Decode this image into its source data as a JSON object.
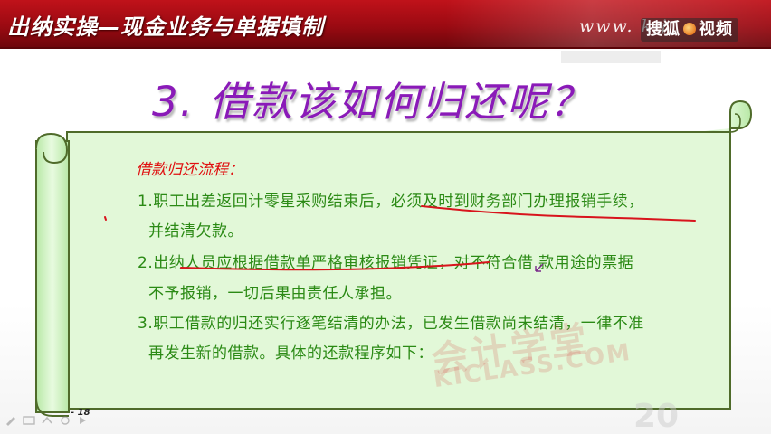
{
  "header": {
    "title": "出纳实操—现金业务与单据填制",
    "url_watermark": "www. k j",
    "logo_text_left": "搜狐",
    "logo_text_right": "视频"
  },
  "slide": {
    "title": "3. 借款该如何归还呢？",
    "flow_heading": "借款归还流程：",
    "steps": [
      "1.职工出差返回计零星采购结束后，必须及时到财务部门办理报销手续，",
      "并结清欠款。",
      "2.出纳人员应根据借款单严格审核报销凭证，对不符合借 款用途的票据",
      "不予报销，一切后果由责任人承担。",
      "3.职工借款的归还实行逐笔结清的办法，已发生借款尚未结清，一律不准",
      "再发生新的借款。具体的还款程序如下："
    ],
    "page_number": "18"
  },
  "watermark": {
    "main": "会计学堂",
    "sub": "KICLASS.COM",
    "corner": "20"
  },
  "annotations": {
    "ink_color": "#d8141c",
    "stroke_color": "#4f6b2a"
  },
  "toolbar_icons": [
    "pen-icon",
    "slide-list-icon",
    "pointer-icon",
    "dropdown-icon",
    "next-icon"
  ]
}
